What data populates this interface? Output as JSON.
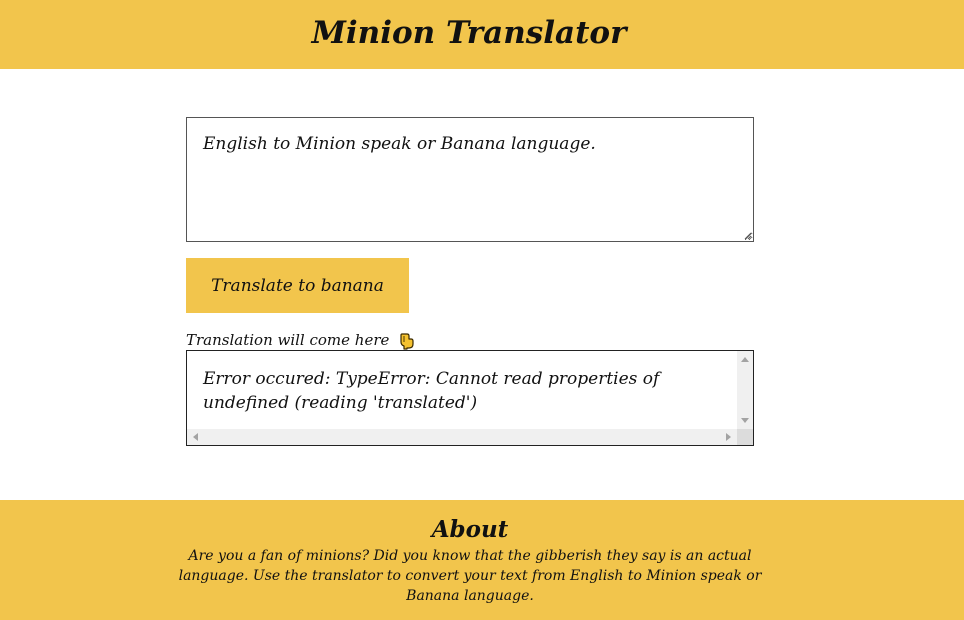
{
  "header": {
    "title": "Minion Translator",
    "background_color": "#F2C54C"
  },
  "input": {
    "placeholder": "English to Minion speak or Banana language."
  },
  "translate_button": {
    "label": "Translate to banana"
  },
  "output": {
    "label": "Translation will come here",
    "label_icon": "pointing-down-hand-icon",
    "text": "Error occured: TypeError: Cannot read properties of undefined (reading 'translated')"
  },
  "footer": {
    "title": "About",
    "text": "Are you a fan of minions? Did you know that the gibberish they say is an actual language. Use the translator to convert your text from English to Minion speak or Banana language.",
    "background_color": "#F2C54C"
  }
}
